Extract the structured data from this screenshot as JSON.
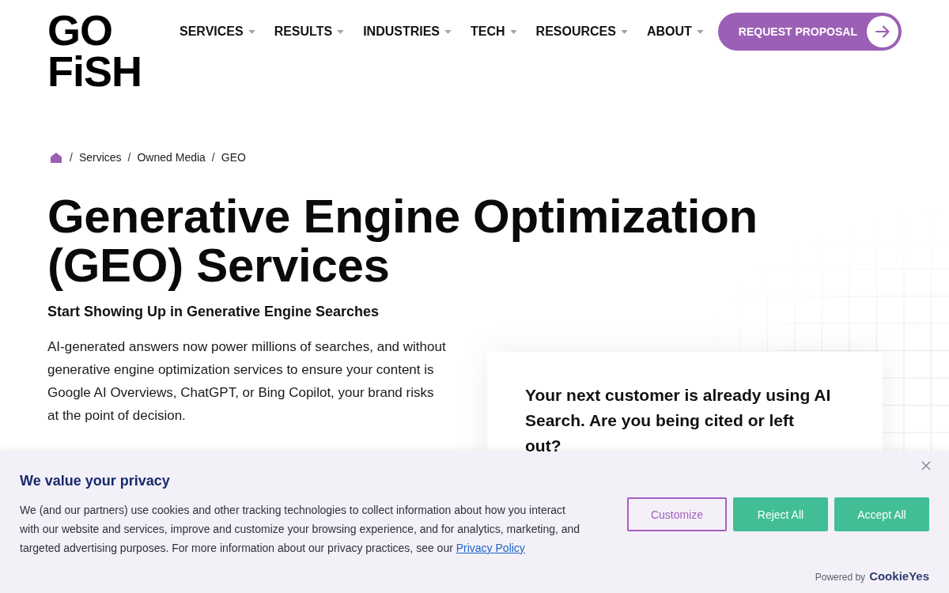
{
  "header": {
    "logo": {
      "line_1": "GO",
      "line_2": "FiSH"
    },
    "nav": [
      {
        "label": "SERVICES",
        "dropdown": true
      },
      {
        "label": "RESULTS",
        "dropdown": true
      },
      {
        "label": "INDUSTRIES",
        "dropdown": true
      },
      {
        "label": "TECH",
        "dropdown": true
      },
      {
        "label": "RESOURCES",
        "dropdown": true
      },
      {
        "label": "ABOUT",
        "dropdown": true
      }
    ],
    "cta_button": {
      "label": "REQUEST PROPOSAL"
    }
  },
  "breadcrumb": [
    {
      "separator": "/",
      "label": "Services"
    },
    {
      "separator": "/",
      "label": "Owned Media"
    },
    {
      "separator": "/",
      "label": "GEO"
    }
  ],
  "hero": {
    "title": "Generative Engine Optimization (GEO) Services",
    "subtitle": "Start Showing Up in Generative Engine Searches",
    "intro_lines": [
      "AI-generated answers now power millions of searches, and without",
      "generative engine optimization services to ensure your content is",
      "Google AI Overviews, ChatGPT, or Bing Copilot, your brand risks",
      "at the point of decision."
    ]
  },
  "callout_card": {
    "text": "Your next customer is already using AI Search. Are you being cited or left out?"
  },
  "cookie_banner": {
    "title": "We value your privacy",
    "text": "We (and our partners) use cookies and other tracking technologies to collect information about how you interact with our website and services, improve and customize your browsing experience, and for analytics, marketing, and targeted advertising purposes. For more information about our privacy practices, see our",
    "link": "Privacy Policy",
    "buttons": [
      {
        "label": "Customize",
        "kind": "outline"
      },
      {
        "label": "Reject All",
        "kind": "filled"
      },
      {
        "label": "Accept All",
        "kind": "filled"
      }
    ],
    "powered_by": "Powered by",
    "brand": "CookieYes"
  }
}
